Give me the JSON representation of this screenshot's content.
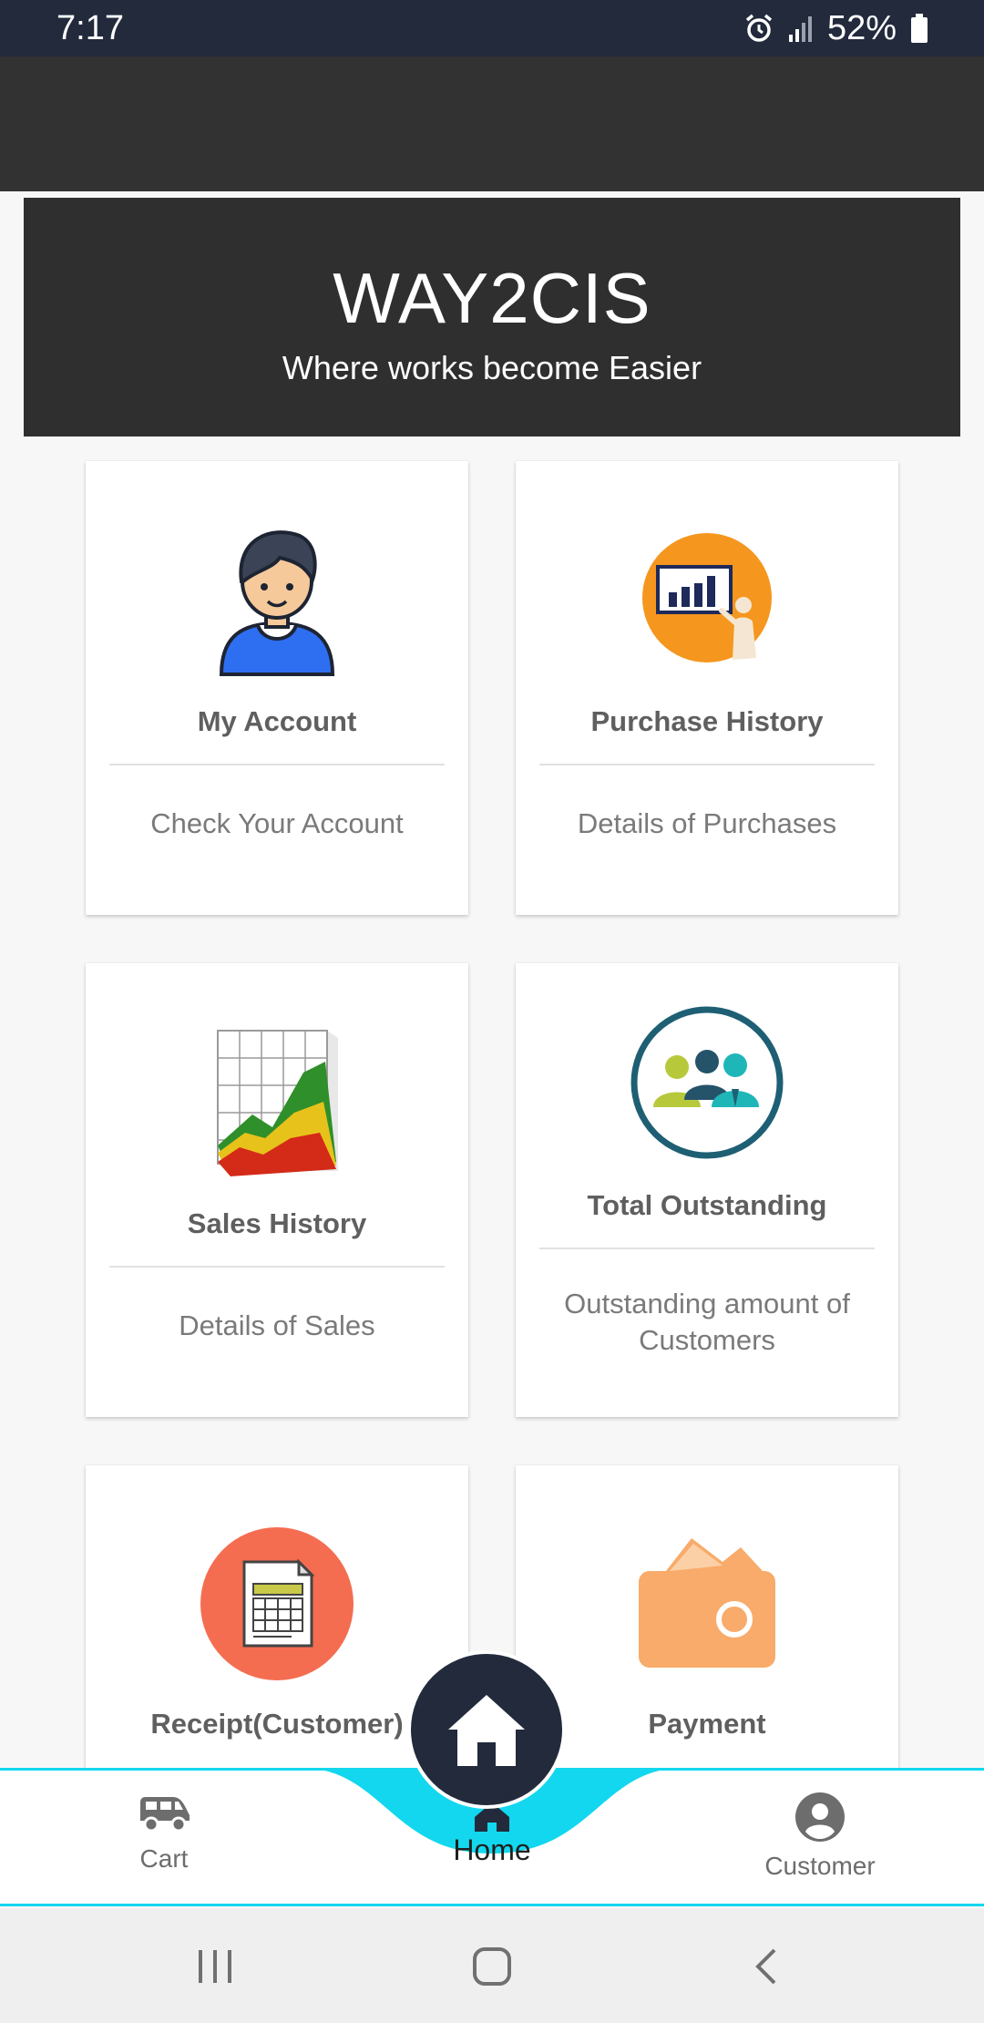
{
  "status_bar": {
    "time": "7:17",
    "battery": "52%"
  },
  "hero": {
    "title": "WAY2CIS",
    "subtitle": "Where works become Easier"
  },
  "cards": [
    {
      "title": "My Account",
      "description": "Check Your Account",
      "icon": "user-avatar-icon"
    },
    {
      "title": "Purchase History",
      "description": "Details of Purchases",
      "icon": "presentation-chart-icon"
    },
    {
      "title": "Sales History",
      "description": "Details of Sales",
      "icon": "area-chart-icon"
    },
    {
      "title": "Total Outstanding",
      "description": "Outstanding amount of Customers",
      "icon": "customers-group-icon"
    },
    {
      "title": "Receipt(Customer)",
      "description": "",
      "icon": "receipt-calculator-icon"
    },
    {
      "title": "Payment",
      "description": "",
      "icon": "wallet-icon"
    }
  ],
  "bottom_nav": {
    "items": [
      {
        "label": "Cart",
        "icon": "van-icon"
      },
      {
        "label": "Home",
        "icon": "home-icon"
      },
      {
        "label": "Customer",
        "icon": "account-circle-icon"
      }
    ],
    "active": "Home"
  },
  "colors": {
    "status_bar": "#222a3c",
    "accent": "#13d7ee",
    "fab": "#222a3c",
    "hero": "#2f2f2f"
  }
}
